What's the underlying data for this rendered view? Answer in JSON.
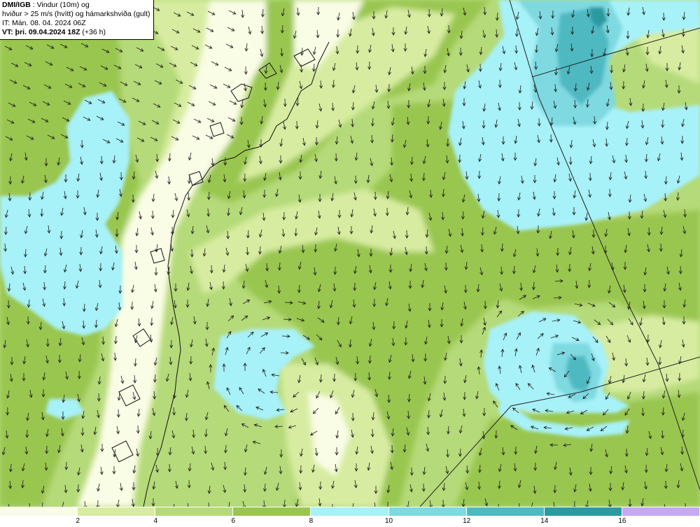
{
  "title": {
    "brand": "DMI/IGB",
    "line1_rest": " : Vindur (10m) og",
    "line2": "hviður > 25 m/s (hvítt) og hámarkshviða (gult)",
    "line3": "IT: Mán. 08. 04. 2024 06Z",
    "line4_bold": "VT: þri. 09.04.2024 18Z",
    "line4_rest": " (+36 h)"
  },
  "legend": {
    "bins": [
      {
        "from": 0,
        "to": 2,
        "color": "#fafde6"
      },
      {
        "from": 2,
        "to": 4,
        "color": "#d7eca0"
      },
      {
        "from": 4,
        "to": 6,
        "color": "#b5da79"
      },
      {
        "from": 6,
        "to": 8,
        "color": "#99c64f"
      },
      {
        "from": 8,
        "to": 10,
        "color": "#a7f1f8"
      },
      {
        "from": 10,
        "to": 12,
        "color": "#7fd9e1"
      },
      {
        "from": 12,
        "to": 14,
        "color": "#4fb9c2"
      },
      {
        "from": 14,
        "to": 16,
        "color": "#2b9aa2"
      },
      {
        "from": 16,
        "to": null,
        "color": "#c5a9f3"
      }
    ],
    "tick_labels": [
      "2",
      "4",
      "6",
      "8",
      "10",
      "12",
      "14",
      "16"
    ],
    "unit": "m/s"
  },
  "map": {
    "field": "wind speed 10 m",
    "arrows": "wind direction, mostly from the north",
    "background_color": "#b5da79"
  }
}
